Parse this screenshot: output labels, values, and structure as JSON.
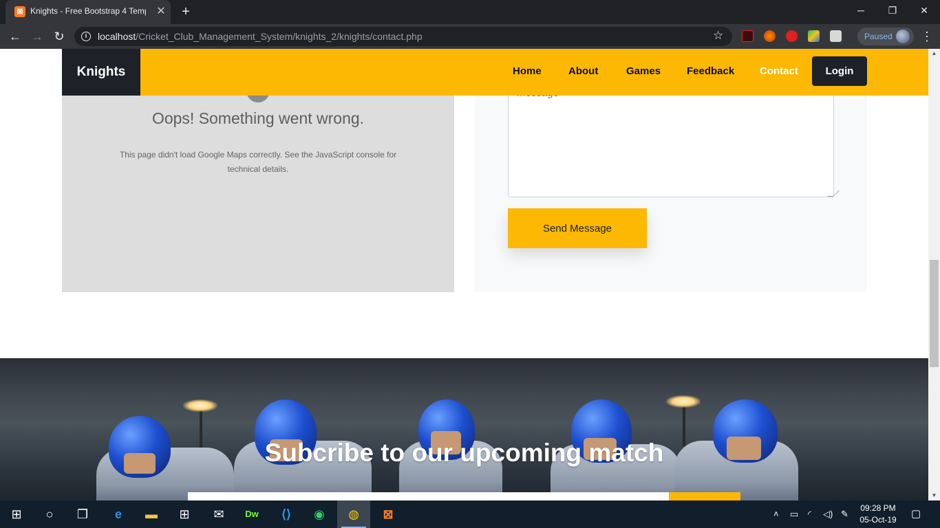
{
  "browser": {
    "tab_title": "Knights - Free Bootstrap 4 Templ",
    "tab_favicon": "xampp-icon",
    "url_host": "localhost",
    "url_path": "/Cricket_Club_Management_System/knights_2/knights/contact.php",
    "profile_status": "Paused",
    "new_tab_symbol": "+",
    "close_tab_symbol": "✕"
  },
  "site": {
    "brand": "Knights",
    "nav": {
      "home": "Home",
      "about": "About",
      "games": "Games",
      "feedback": "Feedback",
      "contact": "Contact",
      "login": "Login"
    },
    "accent_color": "#fdb803",
    "dark_color": "#1d2128"
  },
  "map_error": {
    "title": "Oops! Something went wrong.",
    "body": "This page didn't load Google Maps correctly. See the JavaScript console for technical details."
  },
  "contact_form": {
    "message_placeholder": "Message",
    "send_label": "Send Message"
  },
  "subscribe": {
    "title": "Subcribe to our upcoming match"
  },
  "taskbar": {
    "time": "09:28 PM",
    "date": "05-Oct-19"
  }
}
